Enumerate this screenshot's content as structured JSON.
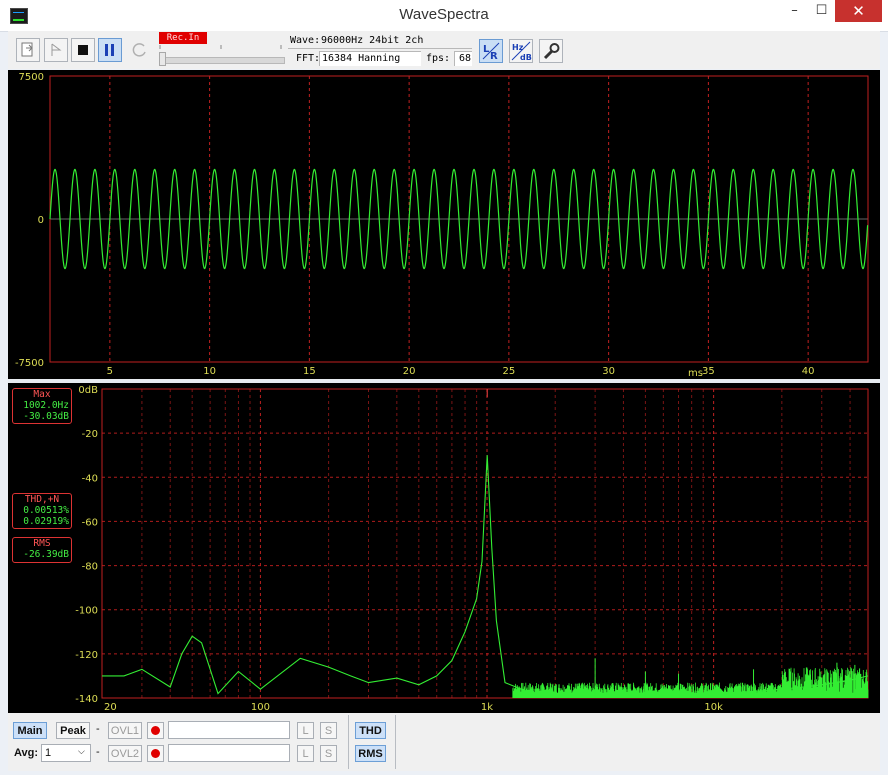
{
  "window": {
    "title": "WaveSpectra",
    "min": "–",
    "max": "☐",
    "close": "✕"
  },
  "toolbar": {
    "rec_indicator": "Rec.In",
    "wave_label": "Wave:",
    "wave_value": "96000Hz 24bit 2ch",
    "fft_label": "FFT:",
    "fft_value": "16384 Hanning",
    "fps_label": "fps:",
    "fps_value": "68",
    "lr_label": "LR",
    "hzdb_label": "Hz dB"
  },
  "waveform": {
    "y_ticks": [
      "7500",
      "0",
      "-7500"
    ],
    "x_ticks": [
      "5",
      "10",
      "15",
      "20",
      "25",
      "30",
      "35",
      "40"
    ],
    "x_unit": "ms",
    "trace_color": "#33ee33",
    "grid_color": "#c02020"
  },
  "spectrum": {
    "y_ticks": [
      "0dB",
      "-20",
      "-40",
      "-60",
      "-80",
      "-100",
      "-120",
      "-140"
    ],
    "x_ticks": [
      "20",
      "100",
      "1k",
      "10k"
    ],
    "trace_color": "#33ee33"
  },
  "readouts": {
    "max": {
      "header": "Max",
      "freq": "1002.0Hz",
      "level": "-30.03dB"
    },
    "thd": {
      "header": "THD,+N",
      "thd": "0.00513%",
      "thdn": "0.02919%"
    },
    "rms": {
      "header": "RMS",
      "level": "-26.39dB"
    }
  },
  "chart_data": [
    {
      "type": "line",
      "title": "",
      "xlabel": "ms",
      "ylabel": "",
      "xlim": [
        2,
        43
      ],
      "ylim": [
        -7500,
        7500
      ],
      "series": [
        {
          "frequency_hz": 1000,
          "amplitude": 2600
        }
      ]
    },
    {
      "type": "line",
      "title": "",
      "xlabel": "",
      "ylabel": "dB",
      "x_scale": "log",
      "xlim": [
        20,
        48000
      ],
      "ylim": [
        -140,
        0
      ],
      "series": [
        {
          "x": [
            20,
            25,
            30,
            40,
            45,
            50,
            55,
            65,
            80,
            100,
            150,
            200,
            250,
            300,
            400,
            500,
            600,
            700,
            800,
            900,
            950,
            1002,
            1050,
            1100,
            1200,
            1500,
            2000,
            3000,
            4000,
            5000,
            6000,
            8000,
            10000,
            15000,
            20000,
            25000,
            30000,
            40000,
            48000
          ],
          "y": [
            -130,
            -130,
            -127,
            -135,
            -120,
            -112,
            -115,
            -138,
            -128,
            -136,
            -122,
            -126,
            -130,
            -133,
            -131,
            -134,
            -130,
            -123,
            -110,
            -95,
            -78,
            -30,
            -72,
            -105,
            -133,
            -137,
            -139,
            -138,
            -139,
            -138,
            -137,
            -138,
            -138,
            -137,
            -136,
            -135,
            -134,
            -132,
            -130
          ]
        }
      ],
      "annotations": [
        {
          "x": 1002,
          "label": "Max 1002.0Hz -30.03dB"
        }
      ]
    }
  ]
}
